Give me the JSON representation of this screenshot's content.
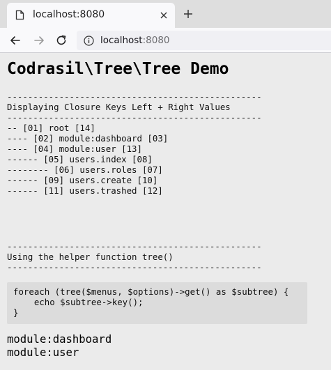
{
  "browser": {
    "tab": {
      "title": "localhost:8080",
      "favicon": "page-icon",
      "close": "close-icon"
    },
    "newtab": "plus-icon",
    "nav": {
      "back": "back-arrow-icon",
      "forward": "forward-arrow-icon",
      "reload": "reload-icon"
    },
    "url": {
      "info_icon": "info-icon",
      "host": "localhost",
      "port": ":8080"
    }
  },
  "page": {
    "title": "Codrasil\\Tree\\Tree Demo",
    "tree_section": {
      "rule_top": "-------------------------------------------------",
      "heading": "Displaying Closure Keys Left + Right Values",
      "rule_bottom": "-------------------------------------------------",
      "items": [
        "-- [01] root [14]",
        "---- [02] module:dashboard [03]",
        "---- [04] module:user [13]",
        "------ [05] users.index [08]",
        "-------- [06] users.roles [07]",
        "------ [09] users.create [10]",
        "------ [11] users.trashed [12]"
      ]
    },
    "helper_section": {
      "rule_top": "-------------------------------------------------",
      "heading": "Using the helper function tree()",
      "rule_bottom": "-------------------------------------------------"
    },
    "code": {
      "line1": "foreach (tree($menus, $options)->get() as $subtree) {",
      "line2": "    echo $subtree->key();",
      "line3": "}"
    },
    "output": [
      "module:dashboard",
      "module:user"
    ]
  },
  "colors": {
    "page_bg": "#ebebeb",
    "code_bg": "#dcdcdc",
    "tabstrip_bg": "#dedede",
    "toolbar_bg": "#f9f9fb"
  }
}
